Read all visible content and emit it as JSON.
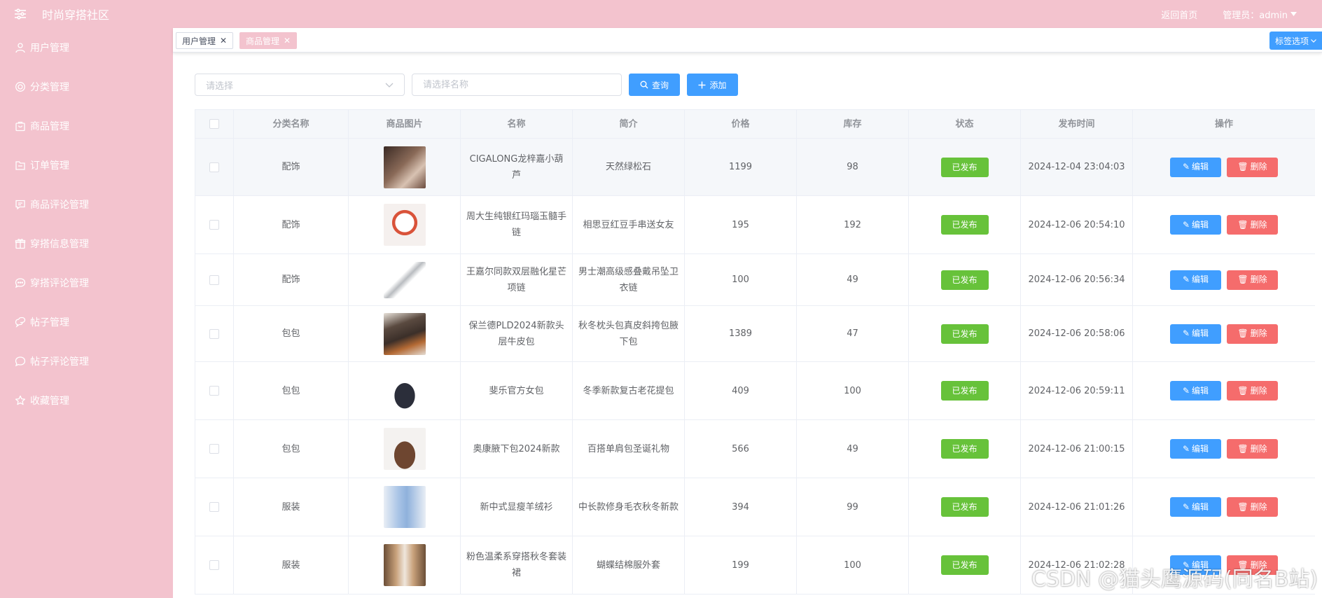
{
  "header": {
    "title": "时尚穿搭社区",
    "home_link": "返回首页",
    "admin_label": "管理员：admin"
  },
  "sidebar": {
    "items": [
      {
        "label": "用户管理",
        "icon": "user-icon"
      },
      {
        "label": "分类管理",
        "icon": "category-icon"
      },
      {
        "label": "商品管理",
        "icon": "goods-icon"
      },
      {
        "label": "订单管理",
        "icon": "order-icon"
      },
      {
        "label": "商品评论管理",
        "icon": "comment-icon"
      },
      {
        "label": "穿搭信息管理",
        "icon": "outfit-icon"
      },
      {
        "label": "穿搭评论管理",
        "icon": "chat-icon"
      },
      {
        "label": "帖子管理",
        "icon": "post-icon"
      },
      {
        "label": "帖子评论管理",
        "icon": "chat-bubble-icon"
      },
      {
        "label": "收藏管理",
        "icon": "star-icon"
      }
    ]
  },
  "tags": {
    "items": [
      {
        "label": "用户管理",
        "active": false
      },
      {
        "label": "商品管理",
        "active": true
      }
    ],
    "options_label": "标签选项"
  },
  "toolbar": {
    "select_placeholder": "请选择",
    "name_placeholder": "请选择名称",
    "query_label": "查询",
    "add_label": "添加"
  },
  "table": {
    "headers": [
      "分类名称",
      "商品图片",
      "名称",
      "简介",
      "价格",
      "库存",
      "状态",
      "发布时间",
      "操作"
    ],
    "edit_label": "编辑",
    "delete_label": "删除",
    "rows": [
      {
        "category": "配饰",
        "name": "CIGALONG龙梓嘉小葫芦",
        "intro": "天然绿松石",
        "price": "1199",
        "stock": "98",
        "status": "已发布",
        "time": "2024-12-04 23:04:03"
      },
      {
        "category": "配饰",
        "name": "周大生纯银红玛瑙玉髓手链",
        "intro": "相思豆红豆手串送女友",
        "price": "195",
        "stock": "192",
        "status": "已发布",
        "time": "2024-12-06 20:54:10"
      },
      {
        "category": "配饰",
        "name": "王嘉尔同款双层融化星芒项链",
        "intro": "男士潮高级感叠戴吊坠卫衣链",
        "price": "100",
        "stock": "49",
        "status": "已发布",
        "time": "2024-12-06 20:56:34"
      },
      {
        "category": "包包",
        "name": "保兰德PLD2024新款头层牛皮包",
        "intro": "秋冬枕头包真皮斜挎包腋下包",
        "price": "1389",
        "stock": "47",
        "status": "已发布",
        "time": "2024-12-06 20:58:06"
      },
      {
        "category": "包包",
        "name": "斐乐官方女包",
        "intro": "冬季新款复古老花提包",
        "price": "409",
        "stock": "100",
        "status": "已发布",
        "time": "2024-12-06 20:59:11"
      },
      {
        "category": "包包",
        "name": "奥康腋下包2024新款",
        "intro": "百搭单肩包圣诞礼物",
        "price": "566",
        "stock": "49",
        "status": "已发布",
        "time": "2024-12-06 21:00:15"
      },
      {
        "category": "服装",
        "name": "新中式显瘦羊绒衫",
        "intro": "中长款修身毛衣秋冬新款",
        "price": "394",
        "stock": "99",
        "status": "已发布",
        "time": "2024-12-06 21:01:26"
      },
      {
        "category": "服装",
        "name": "粉色温柔系穿搭秋冬套装裙",
        "intro": "蝴蝶结棉服外套",
        "price": "199",
        "stock": "100",
        "status": "已发布",
        "time": "2024-12-06 21:02:28"
      }
    ]
  },
  "watermark": "CSDN @猫头鹰源码(同名B站)"
}
